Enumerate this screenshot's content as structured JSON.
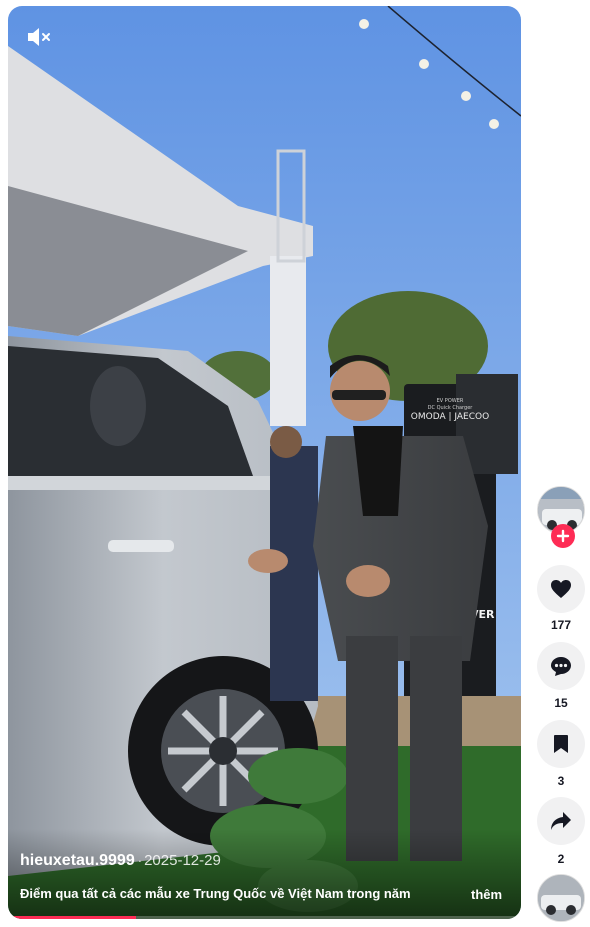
{
  "video": {
    "author": "hieuxetau.9999",
    "separator": "·",
    "date": "2025-12-29",
    "description": "Điểm qua tất cả các mẫu xe Trung Quốc về Việt Nam trong năm",
    "more_label": "thêm",
    "progress": 0.25,
    "mute_icon": "muted-speaker-icon",
    "scene_text": {
      "charger_brand": "OMODA | JAECOO",
      "charger_small": "EV POWER",
      "charger_sub": "DC Quick Charger",
      "charger_side": "VER"
    }
  },
  "actions": {
    "follow_icon": "plus-icon",
    "like_count": "177",
    "comment_count": "15",
    "save_count": "3",
    "share_count": "2"
  },
  "colors": {
    "accent": "#fe2c55",
    "action_bg": "#f1f1f2",
    "count_text": "#161823"
  }
}
